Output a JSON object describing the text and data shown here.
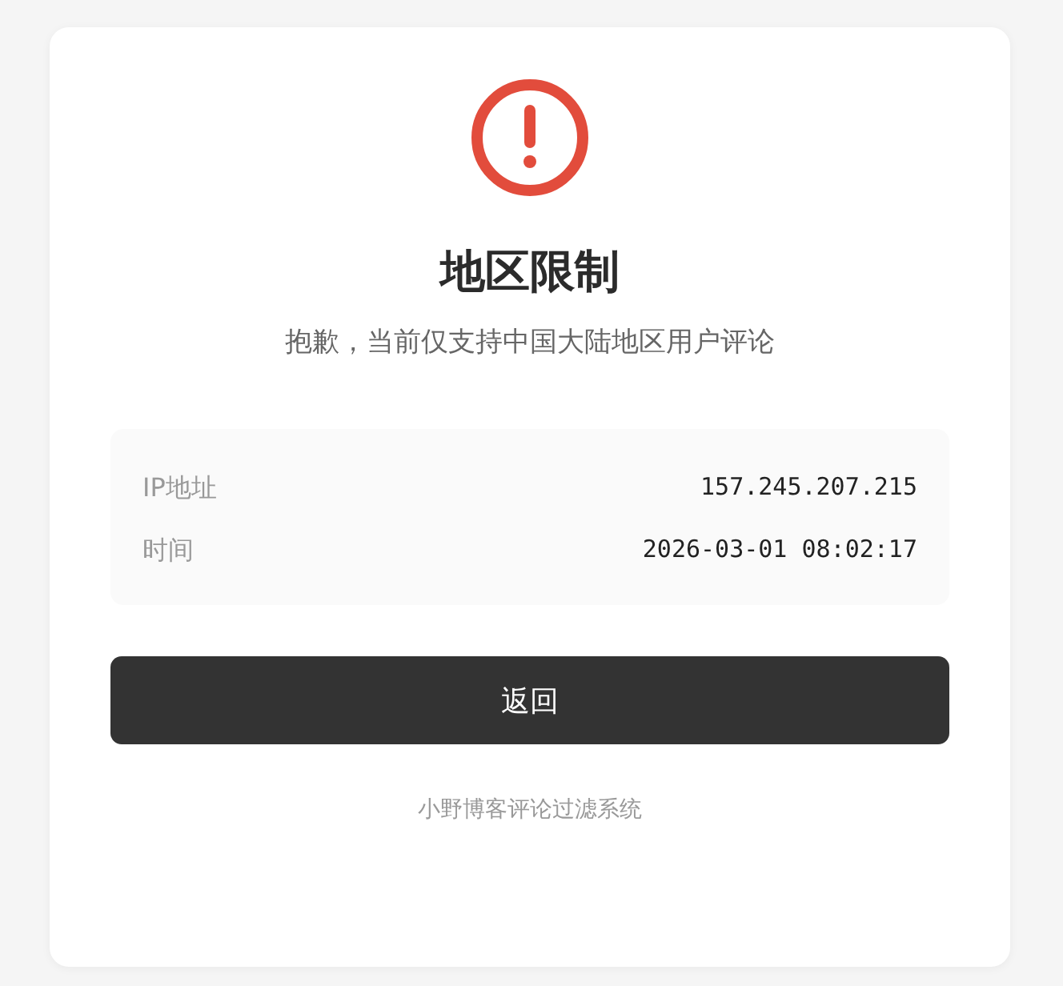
{
  "title": "地区限制",
  "message": "抱歉，当前仅支持中国大陆地区用户评论",
  "details": [
    {
      "label": "IP地址",
      "value": "157.245.207.215"
    },
    {
      "label": "时间",
      "value": "2026-03-01 08:02:17"
    }
  ],
  "button": "返回",
  "footer": "小野博客评论过滤系统"
}
